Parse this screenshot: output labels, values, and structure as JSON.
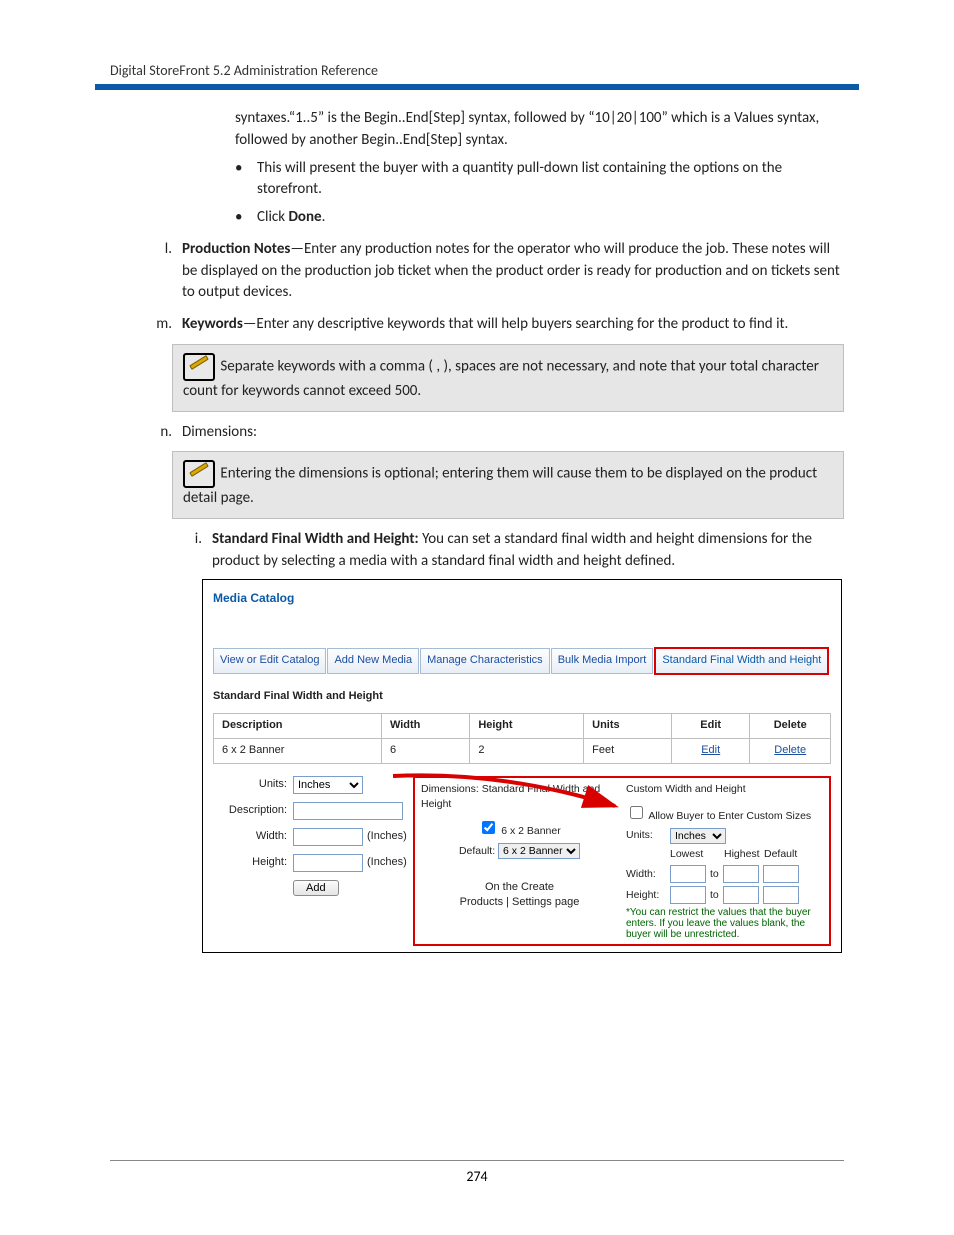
{
  "header": "Digital StoreFront 5.2 Administration Reference",
  "para1": "syntaxes.“1..5” is the Begin..End[Step] syntax, followed by “10|20|100” which is a Values syntax, followed by another Begin..End[Step] syntax.",
  "bul2": "This will present the buyer with a quantity pull-down list containing the options on the storefront.",
  "bul3a": "Click ",
  "bul3b": "Done",
  "bul3c": ".",
  "l_mark": "l.",
  "l_bold": "Production Notes",
  "l_text": "—Enter any production notes for the operator who will produce the job. These notes will be displayed on the production job ticket when the product order is ready for production and on tickets sent to output devices.",
  "m_mark": "m.",
  "m_bold": "Keywords",
  "m_text": "—Enter any descriptive keywords that will help buyers searching for the product to find it.",
  "note1": "Separate keywords with a comma ( , ), spaces are not necessary, and note that your total character count for keywords cannot exceed 500.",
  "n_mark": "n.",
  "n_text": "Dimensions:",
  "note2": "Entering the dimensions is optional; entering them will cause them to be displayed on the product detail page.",
  "i_mark": "i.",
  "i_bold": "Standard Final Width and Height:",
  "i_text": " You can set a standard final width and height dimensions for the product by selecting a media with a standard final width and height defined.",
  "shot": {
    "title": "Media Catalog",
    "tabs": {
      "t1": "View or Edit Catalog",
      "t2": "Add New Media",
      "t3": "Manage Characteristics",
      "t4": "Bulk Media Import",
      "t5": "Standard Final Width and Height"
    },
    "sec": "Standard Final Width and Height",
    "th": {
      "desc": "Description",
      "w": "Width",
      "h": "Height",
      "u": "Units",
      "e": "Edit",
      "d": "Delete"
    },
    "row": {
      "desc": "6 x 2 Banner",
      "w": "6",
      "h": "2",
      "u": "Feet",
      "e": "Edit",
      "d": "Delete"
    },
    "left": {
      "units": "Units:",
      "unitsv": "Inches",
      "desc": "Description:",
      "width": "Width:",
      "inches": "(Inches)",
      "height": "Height:",
      "add": "Add"
    },
    "mid": {
      "hd": "Dimensions: Standard Final Width and Height",
      "cb": "6 x 2 Banner",
      "def": "Default:",
      "defv": "6 x 2 Banner",
      "cap1": "On the Create",
      "cap2": "Products | Settings page"
    },
    "right": {
      "hd": "Custom Width and Height",
      "allow": "Allow Buyer to Enter Custom Sizes",
      "units": "Units:",
      "unitsv": "Inches",
      "low": "Lowest",
      "high": "Highest",
      "defh": "Default",
      "width": "Width:",
      "to": "to",
      "height": "Height:",
      "restr": "*You can restrict the values that the buyer enters. If you leave the values blank, the buyer will be unrestricted."
    }
  },
  "pageNum": "274"
}
